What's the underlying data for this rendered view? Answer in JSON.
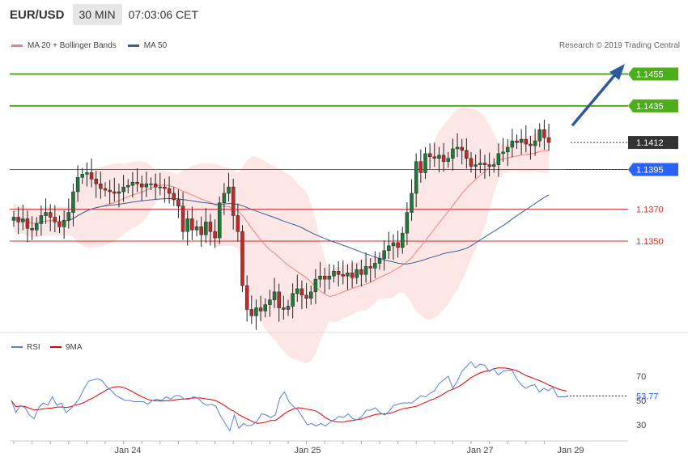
{
  "header": {
    "symbol": "EUR/USD",
    "timeframe": "30 MIN",
    "time": "07:03:06 CET"
  },
  "legend": {
    "ma20": "MA 20 + Bollinger Bands",
    "ma50": "MA 50",
    "ma20_color": "#f08080",
    "ma50_color": "#3a5f9f"
  },
  "credit": "Research © 2019 Trading Central",
  "rsi_legend": {
    "rsi": "RSI",
    "ma9": "9MA",
    "rsi_color": "#5b7fd8",
    "ma9_color": "#e00000"
  },
  "chart_data": [
    {
      "type": "candlestick",
      "title": "",
      "ylim": [
        1.1293,
        1.1468
      ],
      "price_levels": [
        {
          "value": 1.1455,
          "label": "1.1455",
          "color": "#4caf1a",
          "kind": "resistance"
        },
        {
          "value": 1.1435,
          "label": "1.1435",
          "color": "#4caf1a",
          "kind": "resistance"
        },
        {
          "value": 1.1412,
          "label": "1.1412",
          "color": "#333333",
          "kind": "last-price"
        },
        {
          "value": 1.1395,
          "label": "1.1395",
          "color": "#2962ff",
          "kind": "pivot"
        },
        {
          "value": 1.137,
          "label": "1.1370",
          "color": "#d32f2f",
          "kind": "support"
        },
        {
          "value": 1.135,
          "label": "1.1350",
          "color": "#d32f2f",
          "kind": "support"
        }
      ],
      "closes": [
        1.1365,
        1.1362,
        1.1364,
        1.1358,
        1.1357,
        1.1361,
        1.1366,
        1.1368,
        1.1365,
        1.1362,
        1.1359,
        1.1363,
        1.1368,
        1.1381,
        1.139,
        1.1392,
        1.1393,
        1.1389,
        1.1386,
        1.1383,
        1.1382,
        1.1381,
        1.138,
        1.1381,
        1.1384,
        1.1385,
        1.1387,
        1.1386,
        1.1384,
        1.1386,
        1.1386,
        1.1384,
        1.1384,
        1.1383,
        1.138,
        1.1376,
        1.1372,
        1.1356,
        1.1364,
        1.1357,
        1.1359,
        1.1354,
        1.1362,
        1.1356,
        1.1352,
        1.1374,
        1.138,
        1.1384,
        1.1366,
        1.1356,
        1.1322,
        1.1307,
        1.1303,
        1.1308,
        1.1306,
        1.131,
        1.1313,
        1.1318,
        1.1308,
        1.1307,
        1.1309,
        1.1317,
        1.132,
        1.1316,
        1.1314,
        1.1318,
        1.1326,
        1.1328,
        1.1326,
        1.1328,
        1.1331,
        1.1329,
        1.1328,
        1.133,
        1.1327,
        1.1332,
        1.1329,
        1.1334,
        1.1333,
        1.1336,
        1.1339,
        1.1344,
        1.1347,
        1.1349,
        1.1346,
        1.1355,
        1.1368,
        1.138,
        1.14,
        1.1393,
        1.1405,
        1.1403,
        1.1402,
        1.1404,
        1.14,
        1.1402,
        1.1408,
        1.1409,
        1.1407,
        1.1402,
        1.1397,
        1.1398,
        1.1399,
        1.1398,
        1.1397,
        1.1398,
        1.1405,
        1.1406,
        1.1409,
        1.1413,
        1.1412,
        1.1414,
        1.1411,
        1.141,
        1.1413,
        1.142,
        1.1415,
        1.1412
      ],
      "ma50_start_index": 12,
      "rsi_panel": {
        "ylim": [
          20,
          80
        ],
        "levels": [
          30,
          50,
          70
        ],
        "last_rsi": "53.77",
        "rsi": [
          50,
          40,
          46,
          44,
          38,
          35,
          44,
          48,
          46,
          53,
          46,
          48,
          40,
          43,
          47,
          52,
          60,
          66,
          67,
          68,
          66,
          61,
          58,
          54,
          52,
          50,
          50,
          49,
          49,
          49,
          47,
          50,
          51,
          50,
          53,
          51,
          54,
          54,
          51,
          51,
          53,
          52,
          48,
          46,
          47,
          45,
          37,
          31,
          25,
          38,
          27,
          31,
          29,
          30,
          33,
          39,
          38,
          36,
          38,
          52,
          57,
          49,
          45,
          42,
          36,
          30,
          31,
          29,
          31,
          29,
          32,
          34,
          37,
          36,
          39,
          35,
          34,
          37,
          42,
          42,
          44,
          40,
          38,
          41,
          46,
          47,
          48,
          48,
          48,
          51,
          54,
          53,
          56,
          58,
          64,
          67,
          70,
          60,
          66,
          74,
          78,
          82,
          77,
          80,
          79,
          74,
          76,
          71,
          74,
          75,
          75,
          68,
          63,
          60,
          62,
          63,
          57,
          60,
          58,
          61,
          53,
          53,
          53
        ]
      },
      "x_tick_labels": [
        "Jan 24",
        "Jan 25",
        "Jan 27",
        "Jan 29"
      ]
    }
  ]
}
